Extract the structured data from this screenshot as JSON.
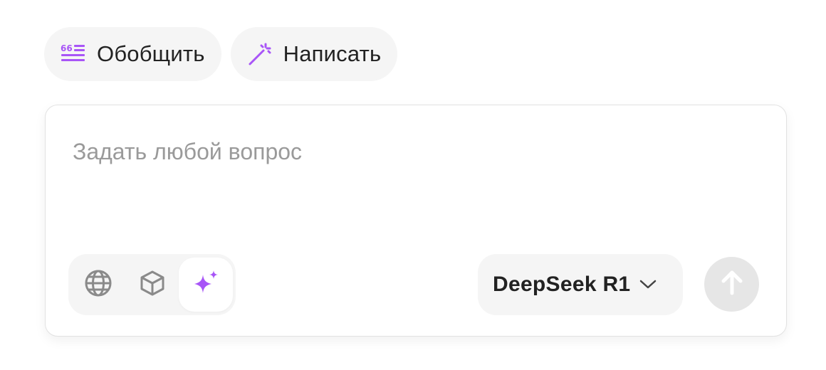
{
  "chips": [
    {
      "label": "Обобщить",
      "icon": "summarize-icon"
    },
    {
      "label": "Написать",
      "icon": "magic-wand-icon"
    }
  ],
  "composer": {
    "placeholder": "Задать любой вопрос"
  },
  "tools": [
    {
      "icon": "globe-icon",
      "active": false
    },
    {
      "icon": "cube-icon",
      "active": false
    },
    {
      "icon": "sparkle-icon",
      "active": true
    }
  ],
  "model": {
    "selected": "DeepSeek R1",
    "icon": "chevron-down-icon"
  },
  "send": {
    "icon": "arrow-up-icon"
  },
  "colors": {
    "accent": "#a855f7",
    "chip_bg": "#f5f5f5",
    "text": "#222222",
    "placeholder": "#9a9a9a",
    "icon_gray": "#8a8a8a",
    "send_bg": "#e6e6e6"
  }
}
